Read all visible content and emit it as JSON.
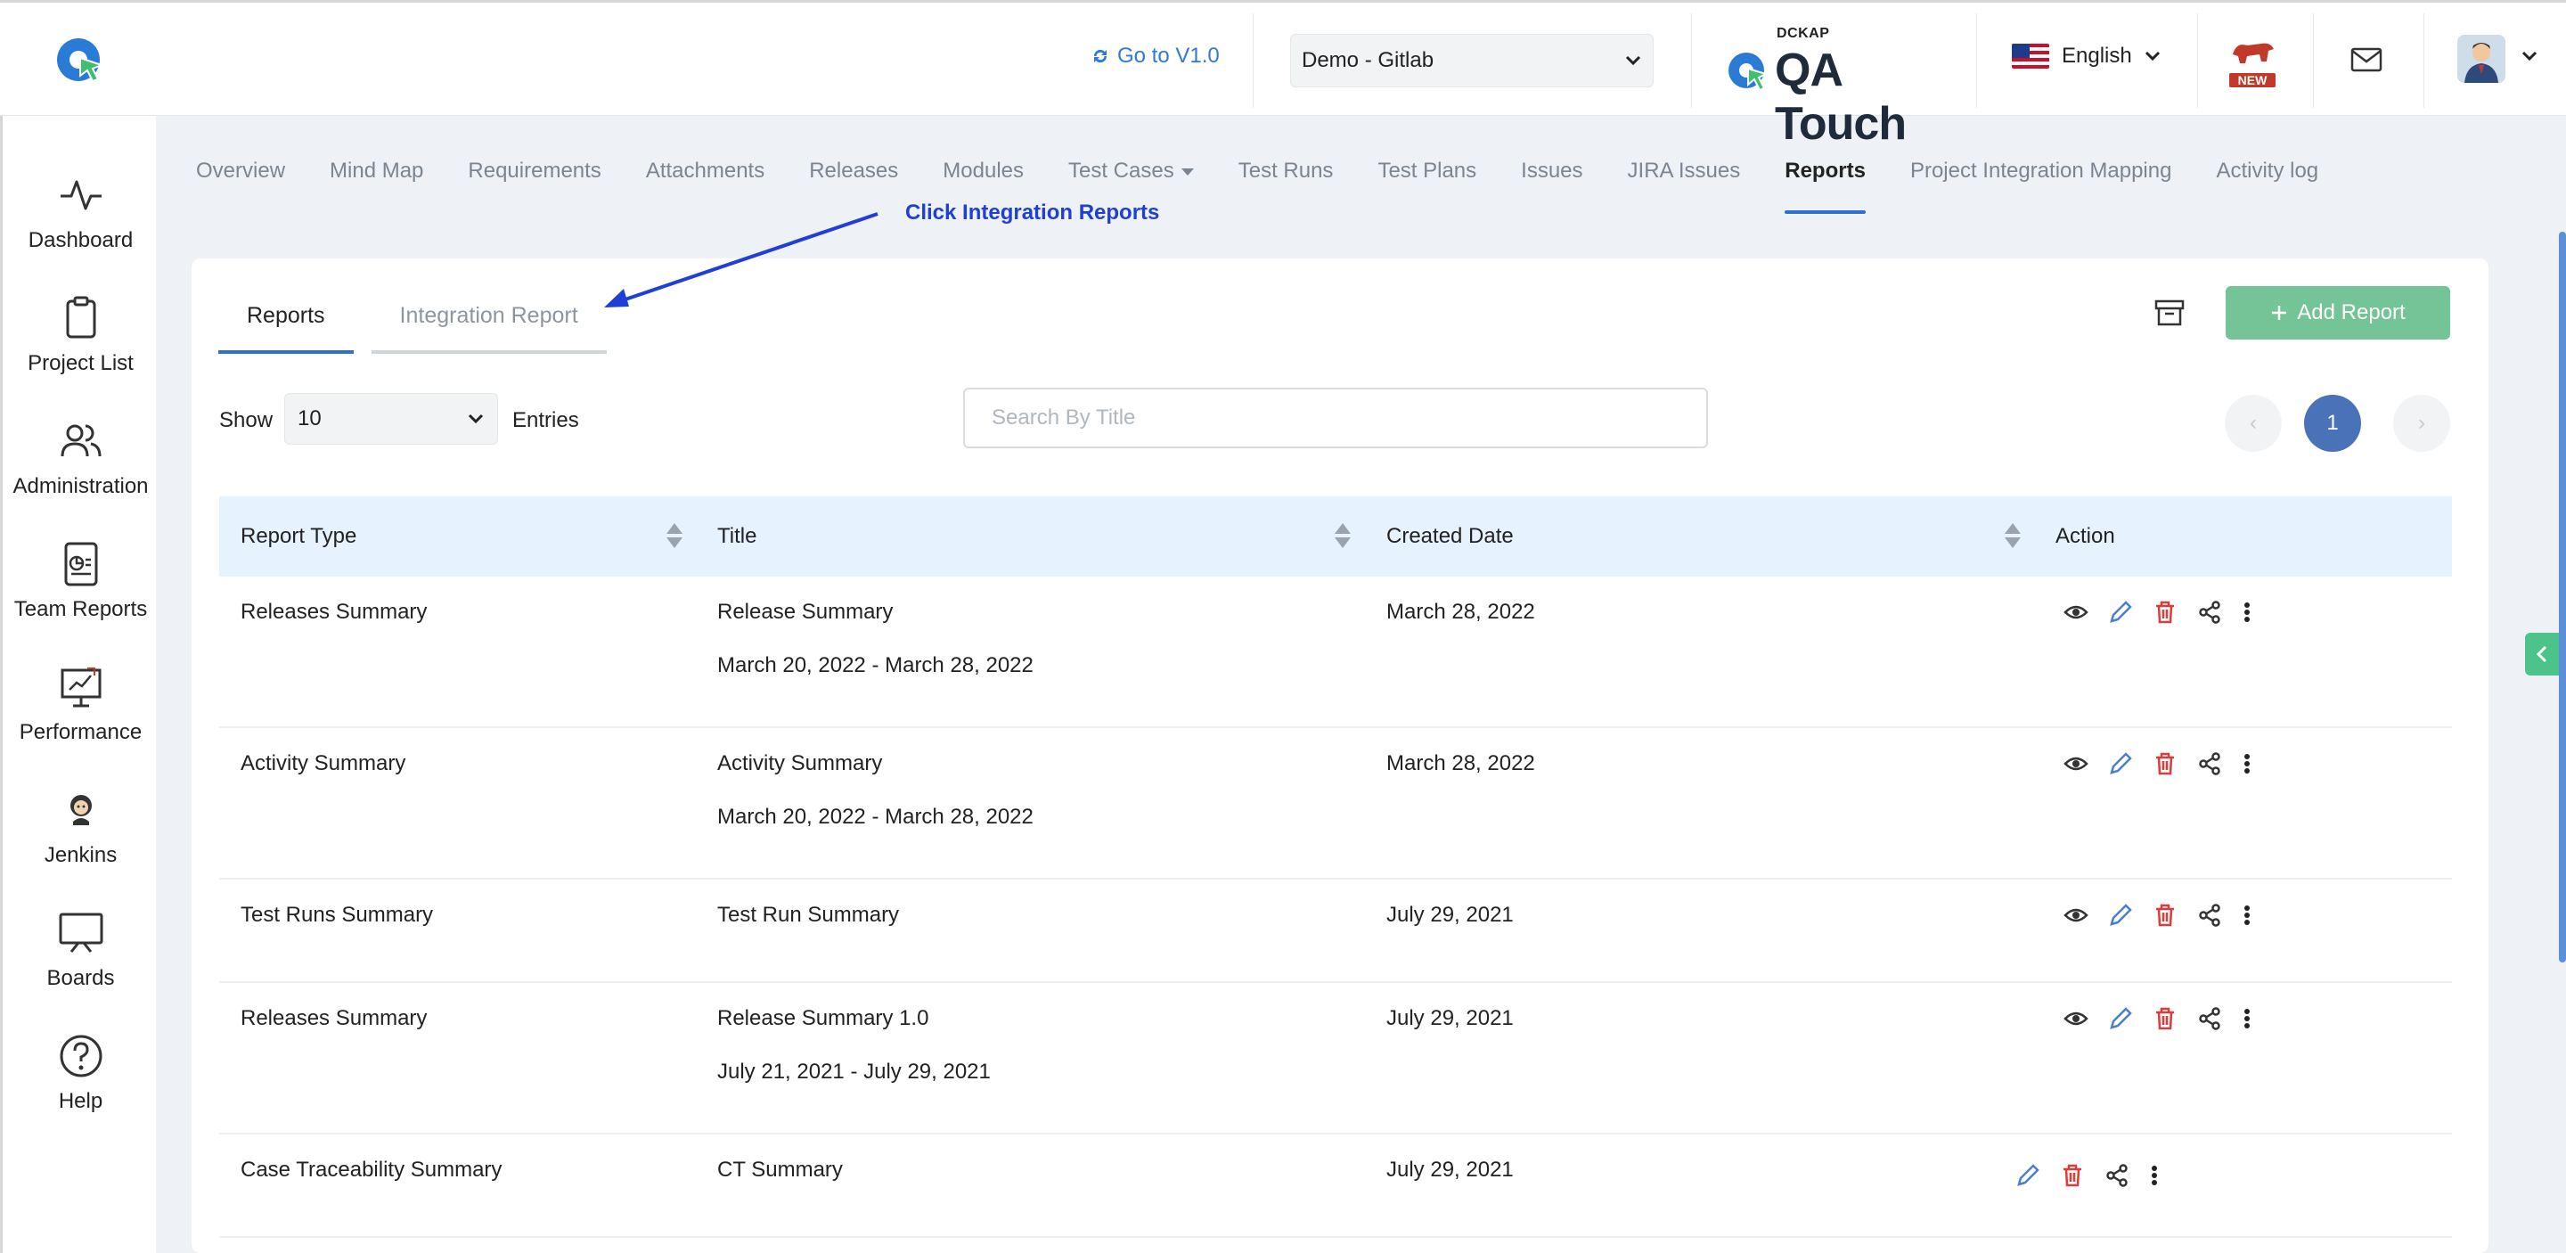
{
  "header": {
    "goto_label": "Go to V1.0",
    "project_select": "Demo - Gitlab",
    "brand_top": "DCKAP",
    "brand_name": "QA Touch",
    "language": "English",
    "new_badge": "NEW"
  },
  "sidebar": {
    "items": [
      {
        "label": "Dashboard",
        "icon": "pulse-icon"
      },
      {
        "label": "Project List",
        "icon": "clipboard-icon"
      },
      {
        "label": "Administration",
        "icon": "users-icon"
      },
      {
        "label": "Team Reports",
        "icon": "report-icon"
      },
      {
        "label": "Performance",
        "icon": "presentation-icon"
      },
      {
        "label": "Jenkins",
        "icon": "jenkins-icon"
      },
      {
        "label": "Boards",
        "icon": "board-icon"
      },
      {
        "label": "Help",
        "icon": "help-icon"
      }
    ]
  },
  "nav": {
    "tabs": [
      "Overview",
      "Mind Map",
      "Requirements",
      "Attachments",
      "Releases",
      "Modules",
      "Test Cases",
      "Test Runs",
      "Test Plans",
      "Issues",
      "JIRA Issues",
      "Reports",
      "Project Integration Mapping",
      "Activity log"
    ],
    "active": "Reports"
  },
  "annotation": "Click Integration Reports",
  "card": {
    "tabs": [
      "Reports",
      "Integration Report"
    ],
    "add_button": "Add Report",
    "show_label": "Show",
    "entries_value": "10",
    "entries_label": "Entries",
    "search_placeholder": "Search By Title",
    "pagination": {
      "prev": "‹",
      "current": "1",
      "next": "›"
    }
  },
  "table": {
    "headers": [
      "Report Type",
      "Title",
      "Created Date",
      "Action"
    ],
    "rows": [
      {
        "type": "Releases Summary",
        "title": "Release Summary",
        "subtitle": "March 20, 2022 - March 28, 2022",
        "date": "March 28, 2022"
      },
      {
        "type": "Activity Summary",
        "title": "Activity Summary",
        "subtitle": "March 20, 2022 - March 28, 2022",
        "date": "March 28, 2022"
      },
      {
        "type": "Test Runs Summary",
        "title": "Test Run Summary",
        "subtitle": "",
        "date": "July 29, 2021"
      },
      {
        "type": "Releases Summary",
        "title": "Release Summary 1.0",
        "subtitle": "July 21, 2021 - July 29, 2021",
        "date": "July 29, 2021"
      },
      {
        "type": "Case Traceability Summary",
        "title": "CT Summary",
        "subtitle": "",
        "date": "July 29, 2021"
      }
    ]
  },
  "colors": {
    "accent": "#2f6fd0",
    "add_button": "#74c497",
    "annotation": "#1f3fd6",
    "delete": "#e03a3a"
  }
}
